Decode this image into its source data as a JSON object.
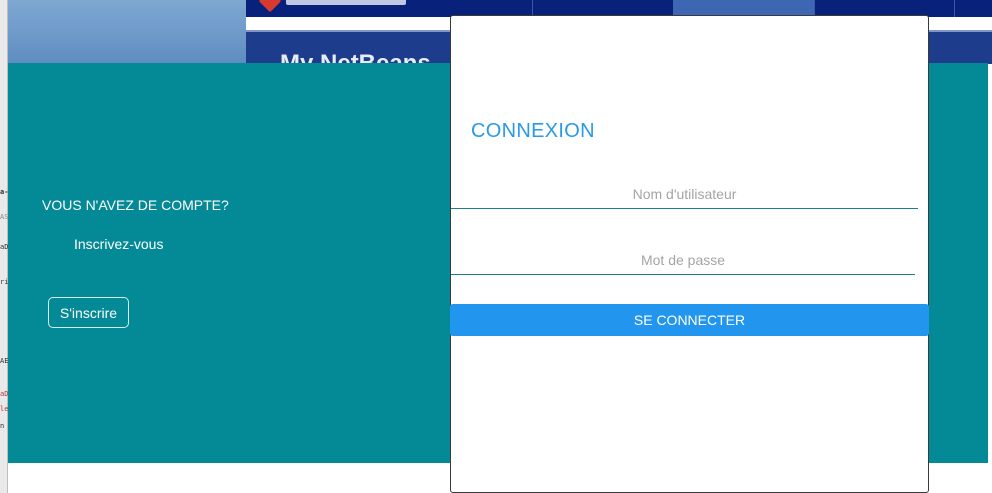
{
  "background_app": {
    "banner_title": "My NetBeans",
    "side_fragments": [
      "a-",
      "AS",
      "aD",
      "ri",
      "AE",
      "aD",
      "le",
      "n"
    ]
  },
  "register_panel": {
    "question": "VOUS N'AVEZ DE COMPTE?",
    "invite": "Inscrivez-vous",
    "signup_button": "S'inscrire"
  },
  "login_card": {
    "title": "CONNEXION",
    "username_placeholder": "Nom d'utilisateur",
    "username_value": "",
    "password_placeholder": "Mot de passe",
    "password_value": "",
    "connect_button": "SE CONNECTER"
  },
  "colors": {
    "teal_panel": "#038a96",
    "accent_blue": "#2296ef",
    "title_blue": "#2a9ae8",
    "header_navy": "#08217a"
  }
}
